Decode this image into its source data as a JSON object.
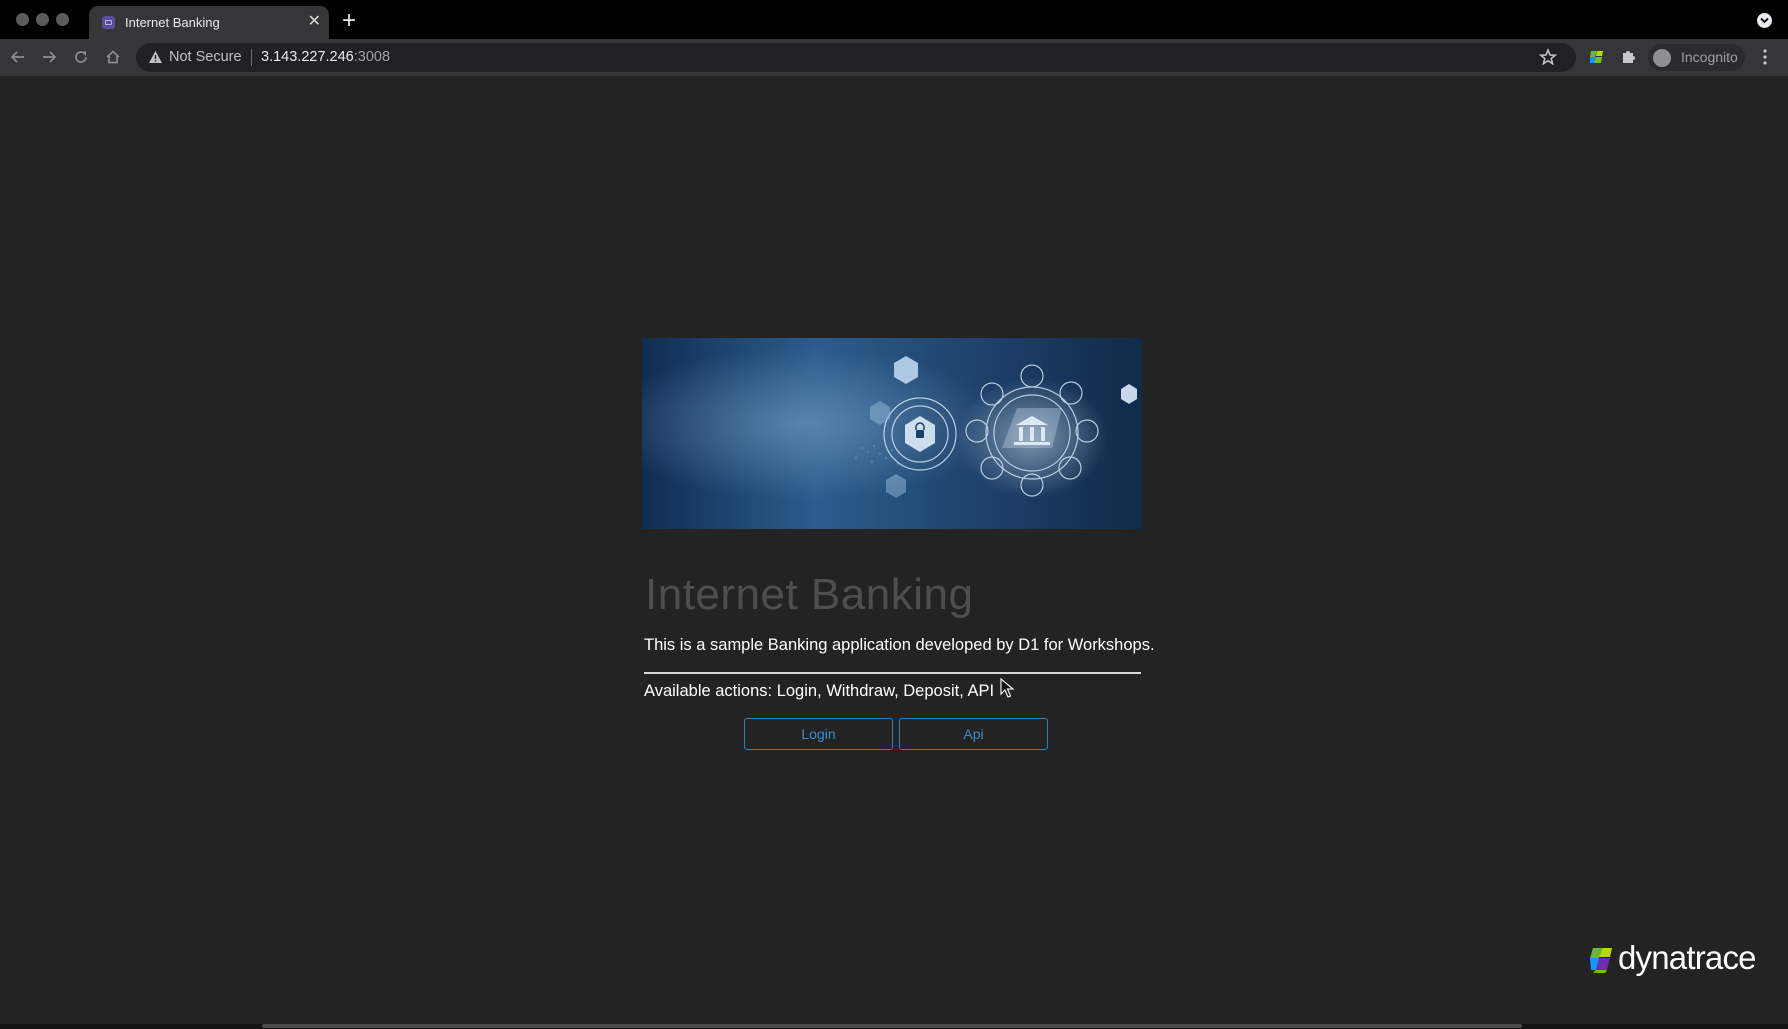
{
  "browser": {
    "tab_title": "Internet Banking",
    "tab_close": "✕",
    "new_tab": "+",
    "security_label": "Not Secure",
    "url_host": "3.143.227.246",
    "url_port": ":3008",
    "profile_label": "Incognito"
  },
  "page": {
    "heading": "Internet Banking",
    "description": "This is a sample Banking application developed by D1 for Workshops.",
    "available_actions": "Available actions: Login, Withdraw, Deposit, API",
    "buttons": {
      "login": "Login",
      "api": "Api"
    },
    "brand_logo": "dynatrace"
  },
  "colors": {
    "page_background": "#232323",
    "button_border": "#2f81b7",
    "button_text": "#3a8cc7",
    "heading_text": "#4e4e4e"
  }
}
